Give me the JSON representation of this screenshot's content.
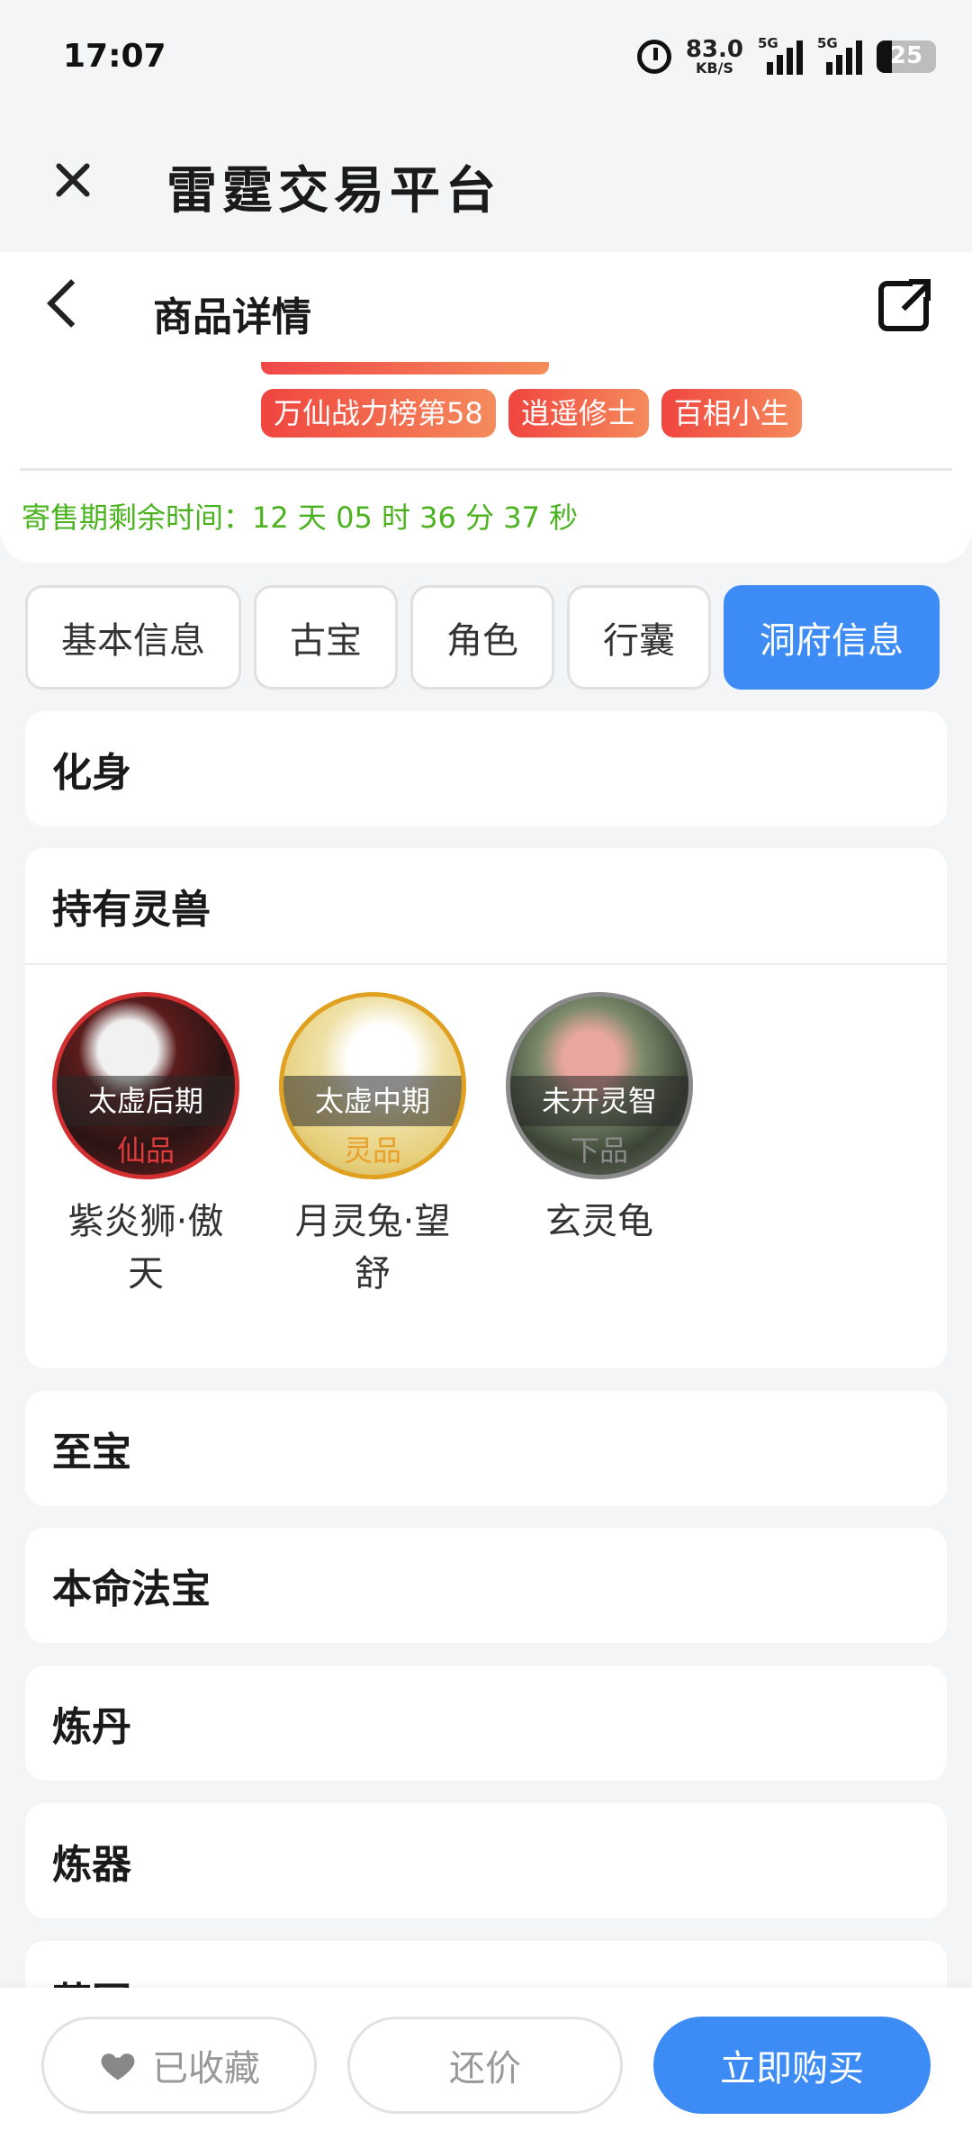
{
  "status_bar": {
    "time": "17:07",
    "speed_value": "83.0",
    "speed_unit": "KB/S",
    "network_1": "5G",
    "network_2": "5G",
    "battery": "25"
  },
  "app": {
    "title": "雷霆交易平台"
  },
  "header": {
    "title": "商品详情"
  },
  "badges": [
    "万仙战力榜第58",
    "逍遥修士",
    "百相小生"
  ],
  "consign": {
    "label": "寄售期剩余时间：",
    "value": "12 天 05 时 36 分 37 秒"
  },
  "tabs": [
    {
      "label": "基本信息",
      "active": false
    },
    {
      "label": "古宝",
      "active": false
    },
    {
      "label": "角色",
      "active": false
    },
    {
      "label": "行囊",
      "active": false
    },
    {
      "label": "洞府信息",
      "active": true
    }
  ],
  "sections": {
    "avatar": "化身",
    "pets": "持有灵兽",
    "treasure": "至宝",
    "natal": "本命法宝",
    "alchemy": "炼丹",
    "forge": "炼器",
    "garden": "药园"
  },
  "pets": [
    {
      "stage": "太虚后期",
      "grade": "仙品",
      "name": "紫炎狮·傲天",
      "grade_color": "#e03a3a",
      "ring_color": "#d23030"
    },
    {
      "stage": "太虚中期",
      "grade": "灵品",
      "name": "月灵兔·望舒",
      "grade_color": "#e8a02a",
      "ring_color": "#e0a020"
    },
    {
      "stage": "未开灵智",
      "grade": "下品",
      "name": "玄灵龟",
      "grade_color": "#8a8a8a",
      "ring_color": "#8a8a8a"
    }
  ],
  "bottom": {
    "favorite": "已收藏",
    "counter_offer": "还价",
    "buy": "立即购买"
  },
  "colors": {
    "accent": "#3d8cf5",
    "badge": "#f0453f",
    "consign": "#4cb320"
  }
}
